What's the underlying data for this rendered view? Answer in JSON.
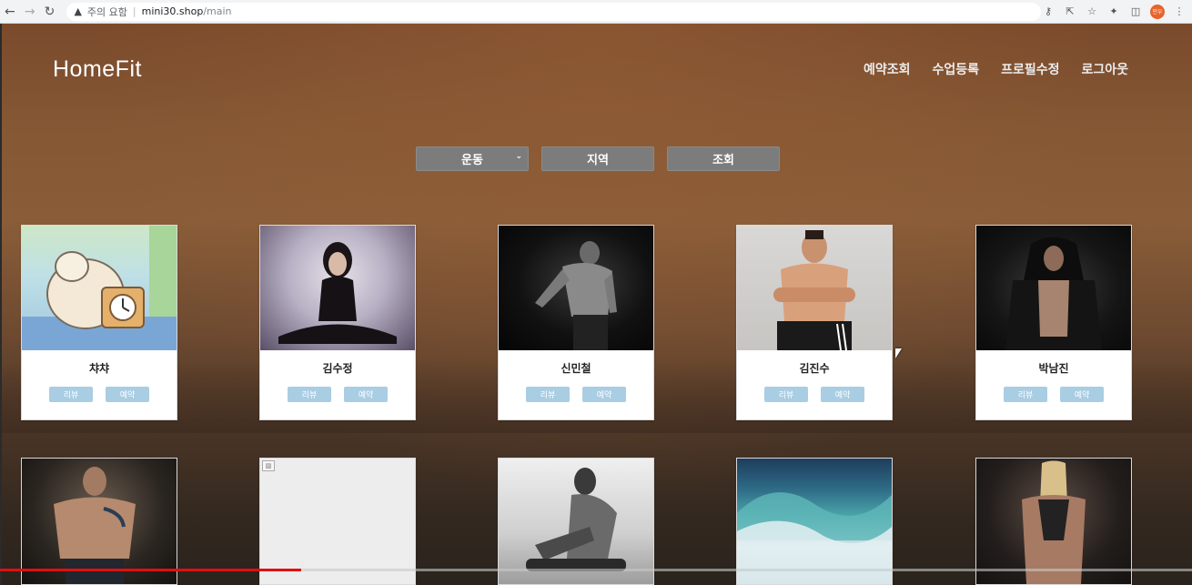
{
  "browser": {
    "security_warning": "주의 요함",
    "separator": "|",
    "url_host": "mini30.shop",
    "url_path": "/main",
    "profile_initials": "민우"
  },
  "site": {
    "brand": "HomeFit",
    "nav": [
      "예약조회",
      "수업등록",
      "프로필수정",
      "로그아웃"
    ]
  },
  "filters": {
    "exercise_select": "운동",
    "region_button": "지역",
    "search_button": "조회"
  },
  "cards": [
    {
      "name": "챠챠",
      "review_label": "리뷰",
      "reserve_label": "예약",
      "photo": "cartoon-cat-clock"
    },
    {
      "name": "김수정",
      "review_label": "리뷰",
      "reserve_label": "예약",
      "photo": "woman-sitting"
    },
    {
      "name": "신민철",
      "review_label": "리뷰",
      "reserve_label": "예약",
      "photo": "muscle-man-dark"
    },
    {
      "name": "김진수",
      "review_label": "리뷰",
      "reserve_label": "예약",
      "photo": "man-arms-crossed"
    },
    {
      "name": "박남진",
      "review_label": "리뷰",
      "reserve_label": "예약",
      "photo": "man-hoodie"
    }
  ],
  "cards_row2": [
    {
      "photo": "tattoo-bodybuilder"
    },
    {
      "photo": "broken-image"
    },
    {
      "photo": "man-sitting-bw"
    },
    {
      "photo": "ocean-wave"
    },
    {
      "photo": "woman-back-muscle"
    }
  ],
  "video_progress": 0.253
}
